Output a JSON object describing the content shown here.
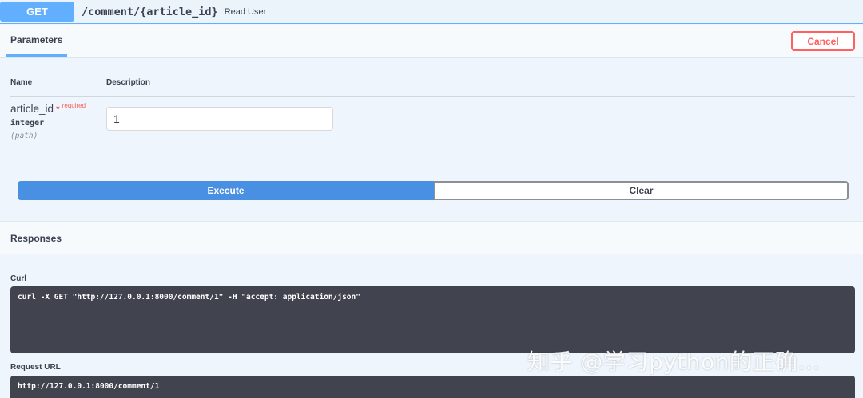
{
  "operation": {
    "method": "GET",
    "path": "/comment/{article_id}",
    "summary": "Read User"
  },
  "parameters_section": {
    "tab_label": "Parameters",
    "cancel_label": "Cancel",
    "columns": {
      "name": "Name",
      "description": "Description"
    },
    "param": {
      "name": "article_id",
      "required_star": "*",
      "required_label": "required",
      "type": "integer",
      "in": "(path)",
      "value": "1"
    },
    "execute_label": "Execute",
    "clear_label": "Clear"
  },
  "responses_section": {
    "title": "Responses",
    "curl_label": "Curl",
    "curl_command": "curl -X GET \"http://127.0.0.1:8000/comment/1\" -H \"accept: application/json\"",
    "request_url_label": "Request URL",
    "request_url": "http://127.0.0.1:8000/comment/1"
  },
  "watermark": "知乎 @学习python的正确…",
  "colors": {
    "get_blue": "#61affe",
    "execute_blue": "#4990e2",
    "cancel_red": "#ff6060",
    "code_bg": "#41444e"
  }
}
